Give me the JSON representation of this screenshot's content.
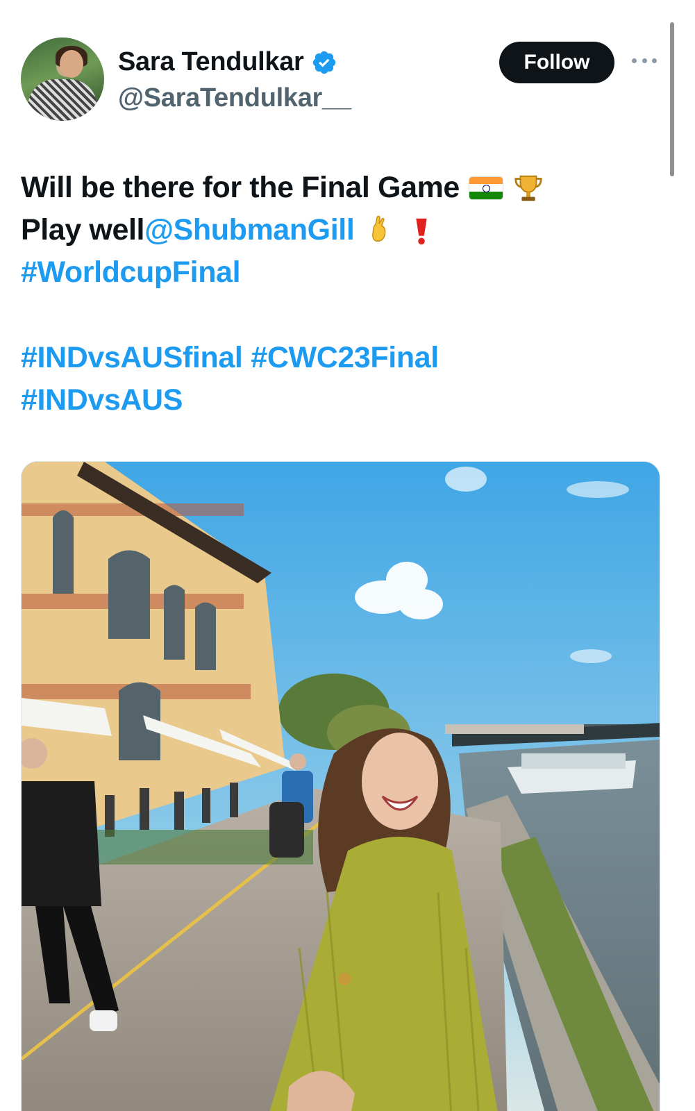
{
  "author": {
    "display_name": "Sara Tendulkar",
    "handle": "@SaraTendulkar__",
    "verified": true
  },
  "actions": {
    "follow_label": "Follow"
  },
  "tweet": {
    "line1_text": "Will be there for the Final Game",
    "line2_text": "Play well ",
    "line2_mention": "@ShubmanGill",
    "line3_hashtag": "#WorldcupFinal",
    "line4_hashtag_a": "#INDvsAUSfinal",
    "line4_hashtag_b": "#CWC23Final",
    "line5_hashtag": "#INDvsAUS",
    "emojis": [
      "india-flag",
      "trophy",
      "crossed-fingers",
      "heavy-exclamation-mark"
    ]
  },
  "colors": {
    "link": "#1d9bf0",
    "text": "#0f1419",
    "secondary": "#536471",
    "verified": "#1d9bf0",
    "follow_bg": "#0f1419"
  }
}
